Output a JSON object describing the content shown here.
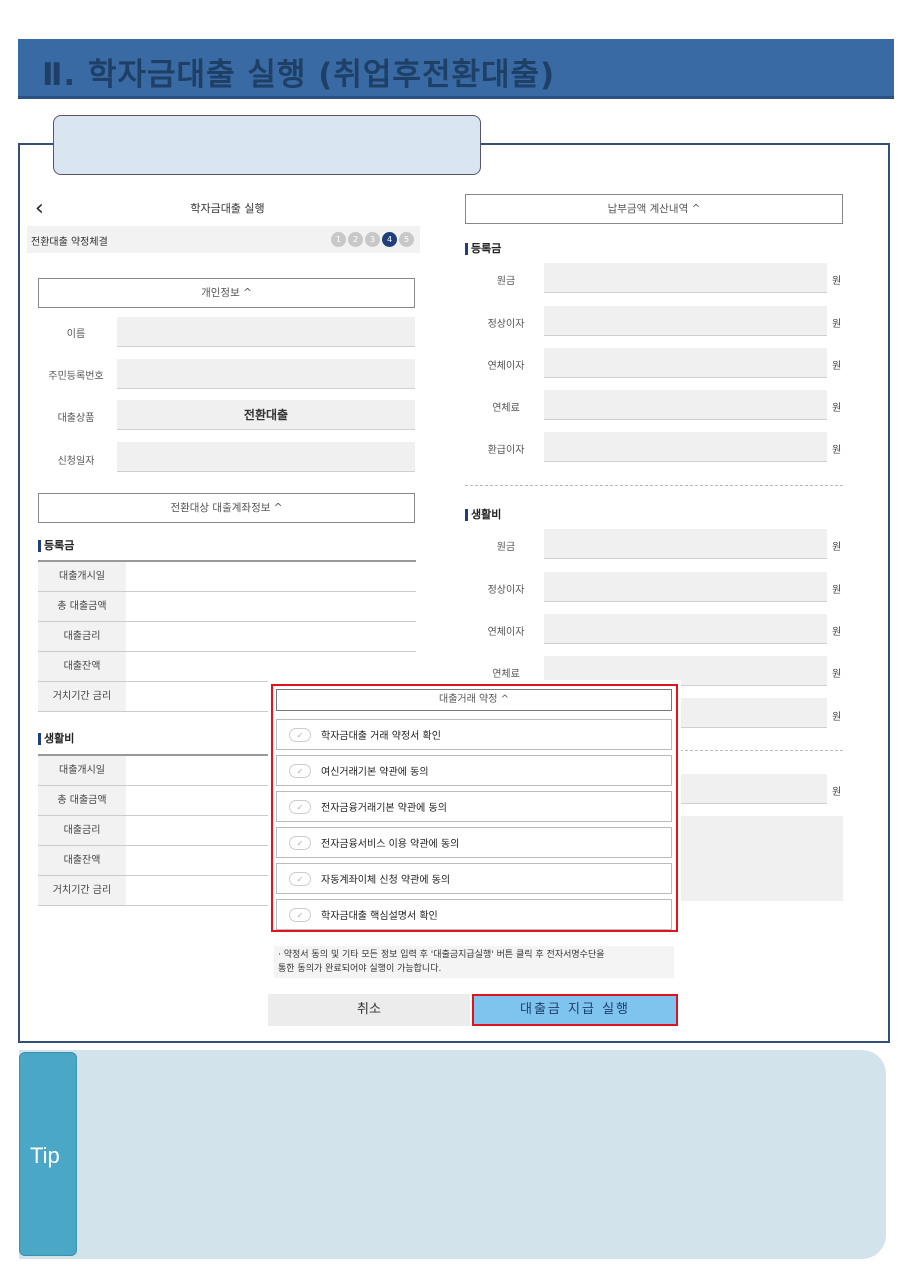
{
  "header": {
    "title": "Ⅱ. 학자금대출 실행 (취업후전환대출)"
  },
  "left": {
    "title": "학자금대출 실행",
    "back_icon": "chevron-left-icon",
    "step_label": "전환대출 약정체결",
    "steps": [
      "1",
      "2",
      "3",
      "4",
      "5"
    ],
    "active_step": 4,
    "personal_section": "개인정보 ^",
    "fields": [
      {
        "label": "이름",
        "value": ""
      },
      {
        "label": "주민등록번호",
        "value": ""
      },
      {
        "label": "대출상품",
        "value": "전환대출"
      },
      {
        "label": "신청일자",
        "value": ""
      }
    ],
    "account_section": "전환대상 대출계좌정보 ^",
    "tuition": {
      "title": "등록금",
      "rows": [
        "대출개시일",
        "총 대출금액",
        "대출금리",
        "대출잔액",
        "거치기간 금리"
      ]
    },
    "living": {
      "title": "생활비",
      "rows": [
        "대출개시일",
        "총 대출금액",
        "대출금리",
        "대출잔액",
        "거치기간 금리"
      ]
    }
  },
  "right": {
    "calc_section": "납부금액 계산내역 ^",
    "tuition": {
      "title": "등록금",
      "rows": [
        "원금",
        "정상이자",
        "연체이자",
        "연체료",
        "환급이자"
      ]
    },
    "living": {
      "title": "생활비",
      "rows": [
        "원금",
        "정상이자",
        "연체이자",
        "연체료"
      ]
    },
    "unit": "원"
  },
  "agreement": {
    "section": "대출거래 약정 ^",
    "items": [
      "학자금대출 거래 약정서 확인",
      "여신거래기본 약관에 동의",
      "전자금융거래기본 약관에 동의",
      "전자금융서비스 이용 약관에 동의",
      "자동계좌이체 신청 약관에 동의",
      "학자금대출 핵심설명서 확인"
    ],
    "notice_line1": "· 약정서 동의 및 기타 모든 정보 입력 후 '대출금지급실행' 버튼 클릭 후 전자서명수단을",
    "notice_line2": "통한 동의가 완료되어야 실행이 가능합니다.",
    "cancel_label": "취소",
    "execute_label": "대출금 지급 실행"
  },
  "tip": {
    "label": "Tip"
  },
  "colors": {
    "banner": "#3a6aa3",
    "highlight": "#e0141e",
    "execute": "#7ec4ee",
    "tip": "#4aa7c5"
  }
}
